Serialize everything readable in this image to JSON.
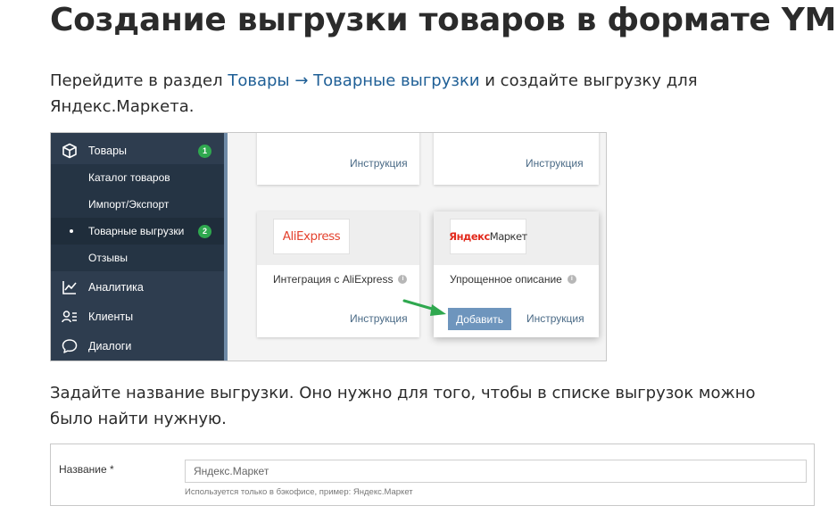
{
  "title": "Создание выгрузки товаров в формате YML",
  "intro": {
    "text_before": "Перейдите в раздел ",
    "link1": "Товары",
    "arrow": " → ",
    "link2": "Товарные выгрузки",
    "text_after": " и создайте выгрузку для Яндекс.Маркета."
  },
  "sidebar": {
    "goods": {
      "label": "Товары",
      "badge": "1"
    },
    "subitems": [
      {
        "label": "Каталог товаров"
      },
      {
        "label": "Импорт/Экспорт"
      },
      {
        "label": "Товарные выгрузки",
        "badge": "2"
      },
      {
        "label": "Отзывы"
      }
    ],
    "analytics": "Аналитика",
    "clients": "Клиенты",
    "dialogs": "Диалоги"
  },
  "cards": {
    "instruction": "Инструкция",
    "aliexpress": {
      "logo": "AliExpress",
      "name": "Интеграция с AliExpress"
    },
    "yandex": {
      "logo_part1": "Яндекс",
      "logo_part2": "Маркет",
      "name": "Упрощенное описание",
      "add": "Добавить"
    }
  },
  "step2": "Задайте название выгрузки. Оно нужно для того, чтобы в списке выгрузок можно было найти нужную.",
  "form": {
    "label": "Название *",
    "value": "Яндекс.Маркет",
    "hint": "Используется только в бэкофисе, пример: Яндекс.Маркет"
  },
  "colors": {
    "sidebar_bg": "#2e3d4f",
    "link": "#1f5f96",
    "badge": "#2fa84f",
    "button": "#6e95bd",
    "arrow": "#2fa84f"
  }
}
